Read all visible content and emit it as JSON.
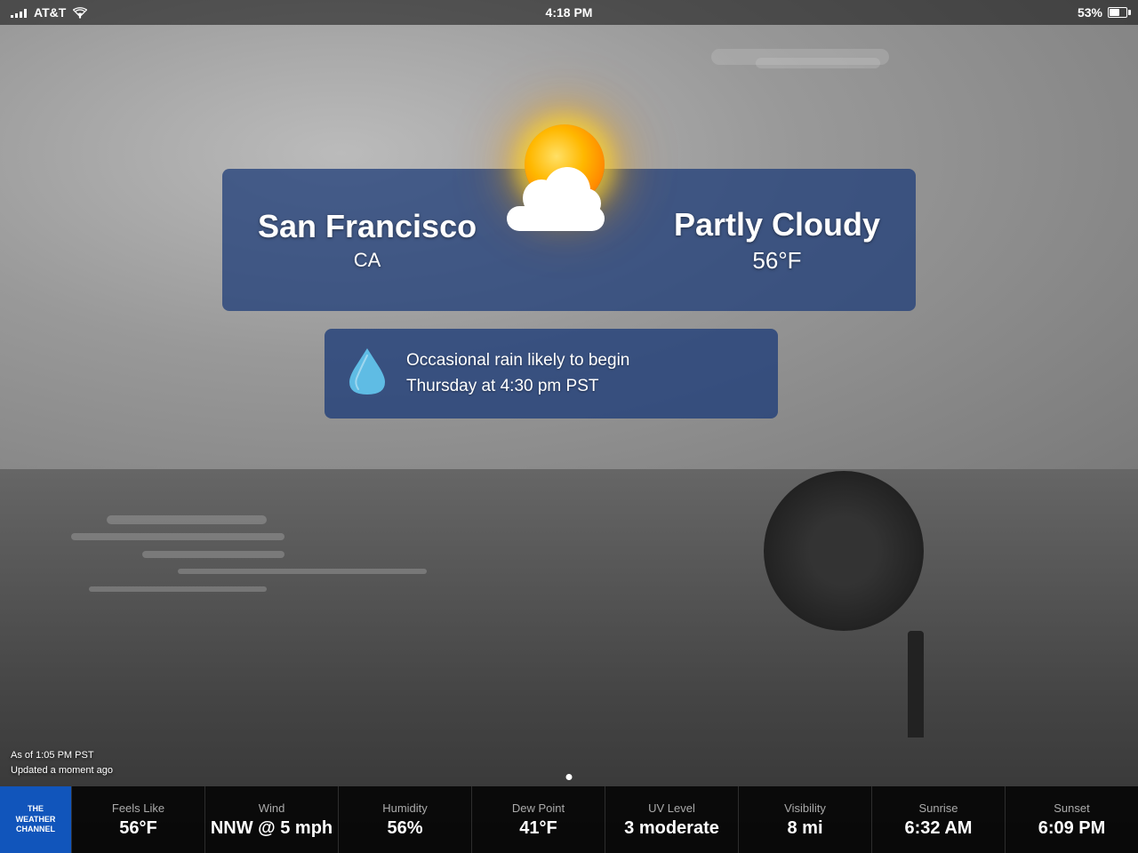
{
  "status_bar": {
    "carrier": "AT&T",
    "time": "4:18 PM",
    "battery_percent": "53%"
  },
  "weather": {
    "city": "San Francisco",
    "state": "CA",
    "condition": "Partly Cloudy",
    "temperature": "56°F",
    "alert_line1": "Occasional rain likely to begin",
    "alert_line2": "Thursday at 4:30 pm PST"
  },
  "update_info": {
    "line1": "As of 1:05 PM PST",
    "line2": "Updated a moment ago"
  },
  "stats": {
    "feels_like_label": "Feels Like",
    "feels_like_value": "56°F",
    "wind_label": "Wind",
    "wind_value": "NNW @ 5 mph",
    "humidity_label": "Humidity",
    "humidity_value": "56%",
    "dew_point_label": "Dew Point",
    "dew_point_value": "41°F",
    "uv_level_label": "UV Level",
    "uv_level_value": "3 moderate",
    "visibility_label": "Visibility",
    "visibility_value": "8 mi",
    "sunrise_label": "Sunrise",
    "sunrise_value": "6:32 AM",
    "sunset_label": "Sunset",
    "sunset_value": "6:09 PM"
  },
  "logo": {
    "line1": "The",
    "line2": "Weather",
    "line3": "Channel"
  }
}
